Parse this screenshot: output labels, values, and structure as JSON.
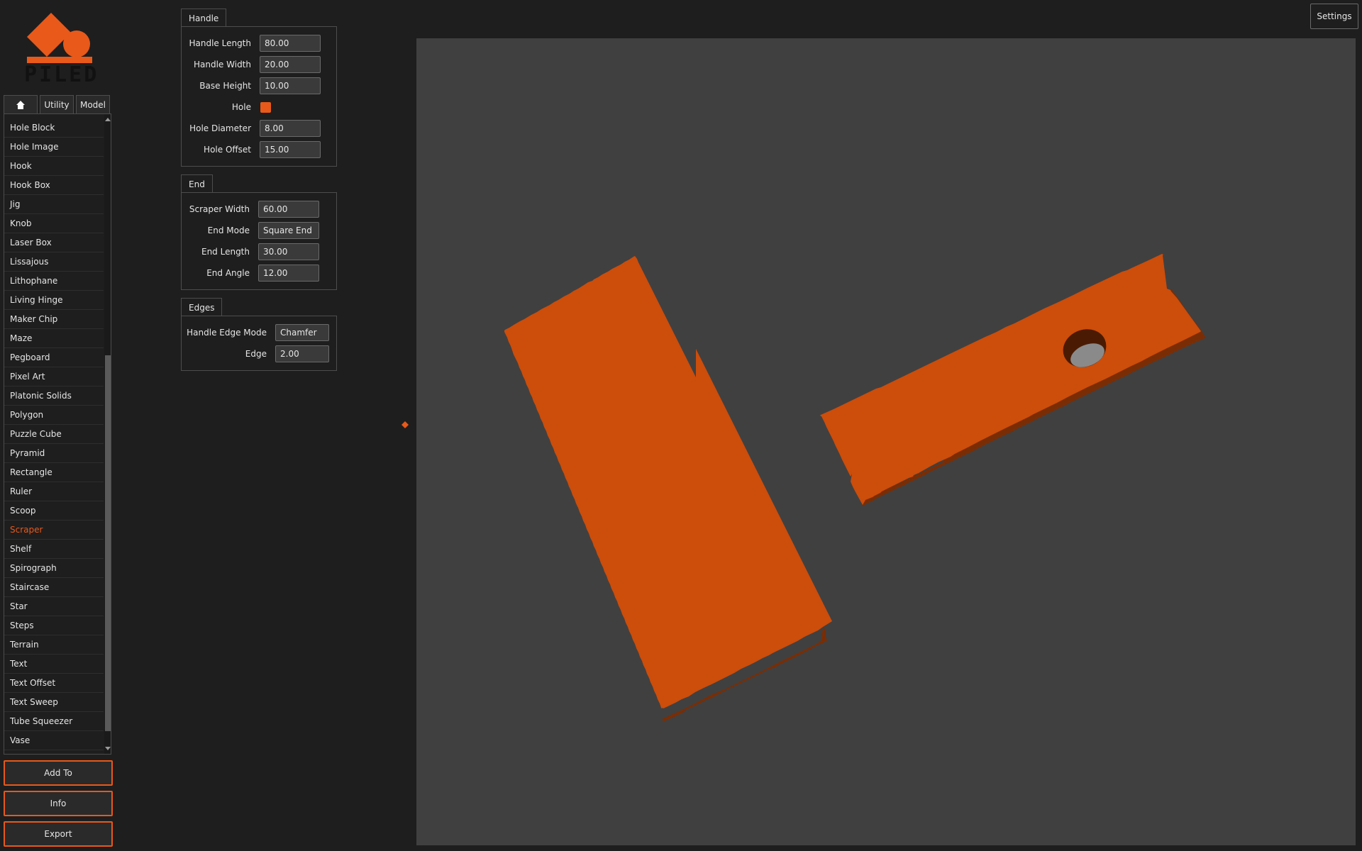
{
  "logo": {
    "text": "PILED"
  },
  "tabs": [
    {
      "label": "",
      "icon": "home-icon"
    },
    {
      "label": "Utility"
    },
    {
      "label": "Model"
    }
  ],
  "model_list": {
    "items": [
      "Hole Block",
      "Hole Image",
      "Hook",
      "Hook Box",
      "Jig",
      "Knob",
      "Laser Box",
      "Lissajous",
      "Lithophane",
      "Living Hinge",
      "Maker Chip",
      "Maze",
      "Pegboard",
      "Pixel Art",
      "Platonic Solids",
      "Polygon",
      "Puzzle Cube",
      "Pyramid",
      "Rectangle",
      "Ruler",
      "Scoop",
      "Scraper",
      "Shelf",
      "Spirograph",
      "Staircase",
      "Star",
      "Steps",
      "Terrain",
      "Text",
      "Text Offset",
      "Text Sweep",
      "Tube Squeezer",
      "Vase"
    ],
    "selected": "Scraper"
  },
  "buttons": {
    "add_to": "Add To",
    "info": "Info",
    "export": "Export"
  },
  "settings": {
    "label": "Settings"
  },
  "groups": {
    "handle": {
      "title": "Handle",
      "handle_length": {
        "label": "Handle Length",
        "value": "80.00"
      },
      "handle_width": {
        "label": "Handle Width",
        "value": "20.00"
      },
      "base_height": {
        "label": "Base Height",
        "value": "10.00"
      },
      "hole": {
        "label": "Hole",
        "checked": true
      },
      "hole_diameter": {
        "label": "Hole Diameter",
        "value": "8.00"
      },
      "hole_offset": {
        "label": "Hole Offset",
        "value": "15.00"
      }
    },
    "end": {
      "title": "End",
      "scraper_width": {
        "label": "Scraper Width",
        "value": "60.00"
      },
      "end_mode": {
        "label": "End Mode",
        "value": "Square End"
      },
      "end_length": {
        "label": "End Length",
        "value": "30.00"
      },
      "end_angle": {
        "label": "End Angle",
        "value": "12.00"
      }
    },
    "edges": {
      "title": "Edges",
      "handle_edge_mode": {
        "label": "Handle Edge Mode",
        "value": "Chamfer"
      },
      "edge": {
        "label": "Edge",
        "value": "2.00"
      }
    }
  },
  "colors": {
    "accent": "#e8591a",
    "model_top": "#cd4d0a",
    "model_side": "#7a2d04",
    "viewport_bg": "#404040",
    "panel_bg": "#1e1e1e"
  }
}
